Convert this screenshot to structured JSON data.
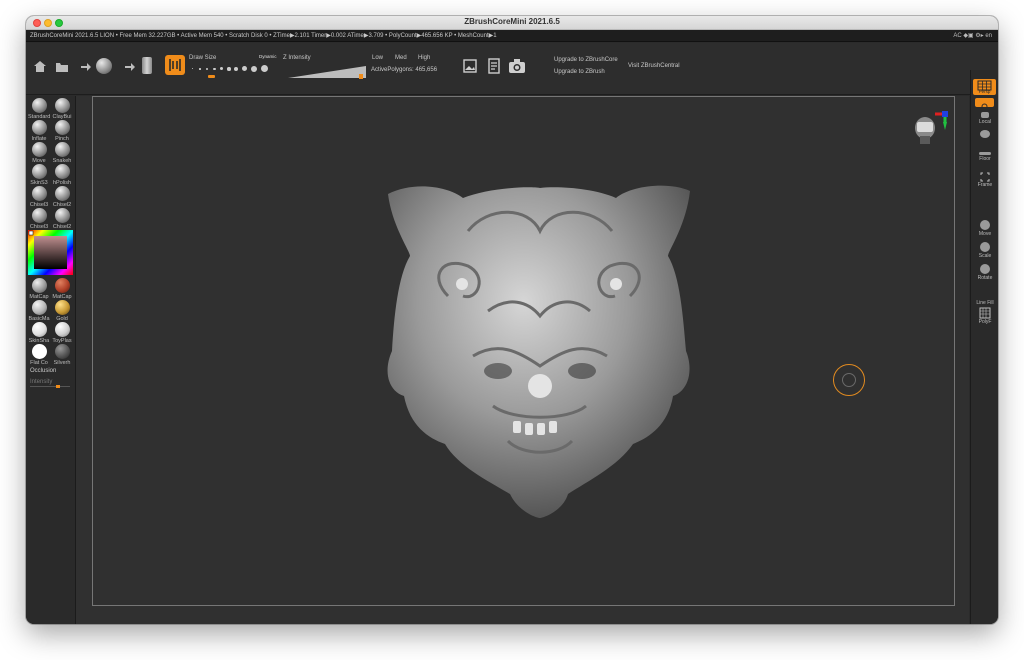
{
  "window": {
    "title": "ZBrushCoreMini 2021.6.5"
  },
  "infobar": {
    "text": "ZBrushCoreMini 2021.6.5 LION   • Free Mem 32.227GB • Active Mem 540 • Scratch Disk 0 •  ZTime▶2.101 Timer▶0.002 ATime▶3.709 • PolyCount▶465.656 KP • MeshCount▶1",
    "right_text": "AC  ◆▣ ⚙▸  en"
  },
  "toolbar": {
    "draw_size_label": "Draw Size",
    "dynamic_label": "Dynamic",
    "z_intensity_label": "Z Intensity",
    "low_label": "Low",
    "med_label": "Med",
    "high_label": "High",
    "active_polygons_label": "ActivePolygons: 465,656",
    "upgrade_core_label": "Upgrade to ZBrushCore",
    "upgrade_zbrush_label": "Upgrade to ZBrush",
    "visit_central_label": "Visit ZBrushCentral"
  },
  "left_panel": {
    "brushes": [
      {
        "name": "Standard"
      },
      {
        "name": "ClayBui"
      },
      {
        "name": "Inflate"
      },
      {
        "name": "Pinch"
      },
      {
        "name": "Move"
      },
      {
        "name": "Snakeh"
      },
      {
        "name": "SkinS3"
      },
      {
        "name": "hPolish"
      },
      {
        "name": "Chisel3"
      },
      {
        "name": "Chisel2"
      },
      {
        "name": "Chisel3"
      },
      {
        "name": "Chisel2"
      }
    ],
    "materials": [
      {
        "name": "MatCap",
        "color": "#9a9a9a"
      },
      {
        "name": "MatCap",
        "color": "#b04028"
      },
      {
        "name": "BasicMa",
        "color": "#b5b5b5"
      },
      {
        "name": "Gold",
        "color": "#c89a35"
      },
      {
        "name": "SkinSha",
        "color": "#e0e0e0"
      },
      {
        "name": "ToyPlas",
        "color": "#cfcfcf"
      },
      {
        "name": "Flat Co",
        "color": "#ffffff"
      },
      {
        "name": "Silverh",
        "color": "#555555"
      }
    ],
    "occlusion_label": "Occlusion",
    "intensity_label": "Intensity"
  },
  "right_panel": {
    "items": [
      {
        "label": "Persp"
      },
      {
        "label": "Floor"
      },
      {
        "label": "Local"
      },
      {
        "label": "Frame"
      },
      {
        "label": "Move"
      },
      {
        "label": "Scale"
      },
      {
        "label": "Rotate"
      },
      {
        "label": "Line Fill"
      },
      {
        "label": "PolyF"
      }
    ]
  },
  "colors": {
    "accent": "#f08c1a",
    "canvas_bg": "#303030",
    "panel_bg": "#2a2a2a",
    "gizmo_red": "#e02020",
    "gizmo_green": "#20c040",
    "gizmo_blue": "#2040e0"
  }
}
